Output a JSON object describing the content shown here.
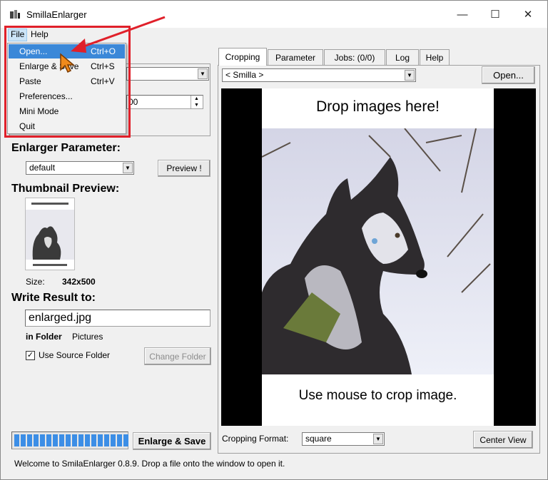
{
  "window": {
    "title": "SmillaEnlarger",
    "controls": {
      "minimize": "—",
      "maximize": "☐",
      "close": "✕"
    }
  },
  "menu": {
    "file": "File",
    "help": "Help"
  },
  "file_menu": [
    {
      "label": "Open...",
      "shortcut": "Ctrl+O",
      "highlighted": true
    },
    {
      "label": "Enlarge & Save",
      "shortcut": "Ctrl+S"
    },
    {
      "label": "Paste",
      "shortcut": "Ctrl+V"
    },
    {
      "label": "Preferences...",
      "shortcut": ""
    },
    {
      "label": "Mini Mode",
      "shortcut": ""
    },
    {
      "label": "Quit",
      "shortcut": ""
    }
  ],
  "left": {
    "partial_value": "00",
    "enlarger_parameter_heading": "Enlarger Parameter:",
    "parameter_select": "default",
    "preview_button": "Preview !",
    "thumbnail_heading": "Thumbnail Preview:",
    "size_label": "Size:",
    "size_value": "342x500",
    "write_result_heading": "Write Result to:",
    "output_filename": "enlarged.jpg",
    "in_folder_label": "in Folder",
    "folder_value": "Pictures",
    "use_source_folder_label": "Use Source Folder",
    "use_source_folder_checked": true,
    "change_folder_button": "Change Folder",
    "enlarge_save_button": "Enlarge & Save",
    "progress_percent": 100
  },
  "tabs": [
    {
      "label": "Cropping",
      "active": true
    },
    {
      "label": "Parameter"
    },
    {
      "label": "Jobs: (0/0)"
    },
    {
      "label": "Log"
    },
    {
      "label": "Help"
    }
  ],
  "right": {
    "source_select": "< Smilla >",
    "open_button": "Open...",
    "image_top_caption": "Drop images here!",
    "image_bottom_caption": "Use mouse to crop image.",
    "cropping_format_label": "Cropping Format:",
    "cropping_format_value": "square",
    "center_view_button": "Center View"
  },
  "statusbar": {
    "text": "Welcome to SmilaEnlarger 0.8.9.  Drop a file onto the window to open it."
  },
  "colors": {
    "annotation_red": "#e0202a",
    "highlight": "#3b88d8",
    "progress": "#3c8ee6"
  }
}
